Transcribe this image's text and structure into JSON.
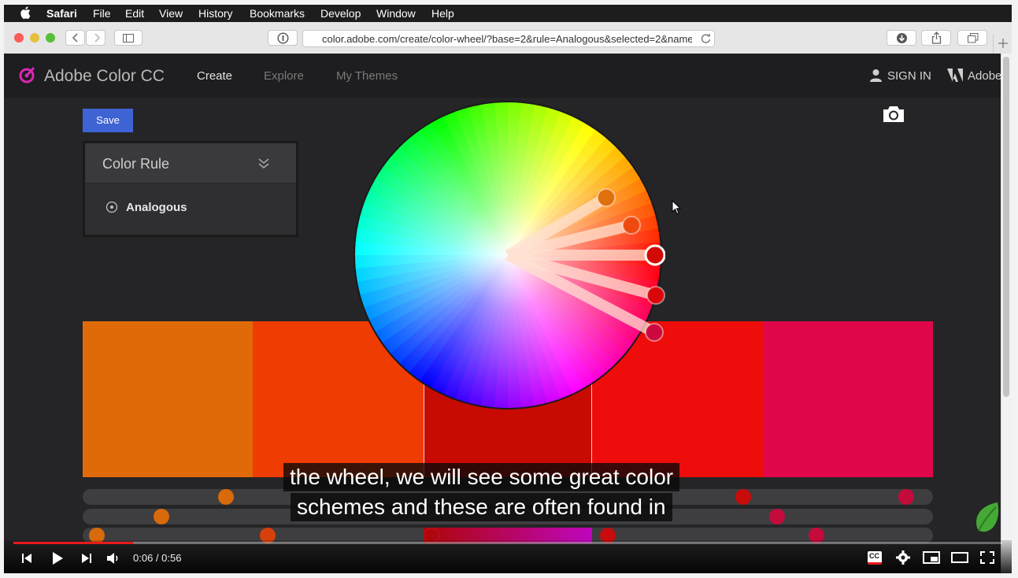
{
  "menubar": {
    "app": "Safari",
    "items": [
      "File",
      "Edit",
      "View",
      "History",
      "Bookmarks",
      "Develop",
      "Window",
      "Help"
    ]
  },
  "browser": {
    "url": "color.adobe.com/create/color-wheel/?base=2&rule=Analogous&selected=2&name"
  },
  "site": {
    "brand": "Adobe Color CC",
    "nav": [
      "Create",
      "Explore",
      "My Themes"
    ],
    "sign_in": "SIGN IN",
    "adobe": "Adobe"
  },
  "editor": {
    "save_label": "Save",
    "rule_title": "Color Rule",
    "rule_value": "Analogous"
  },
  "swatches": [
    "#e06a08",
    "#ee3c02",
    "#c70b02",
    "#ee0d0a",
    "#e0064a"
  ],
  "caption": {
    "line1": "the wheel, we will see some great color",
    "line2": "schemes and these are often found in"
  },
  "player": {
    "time": "0:06 / 0:56",
    "progress_fraction": 0.121,
    "cc_label": "CC"
  },
  "colors": {
    "accent": "#3e63d4",
    "progress": "#e61b1b",
    "logo": "#d928b4"
  }
}
